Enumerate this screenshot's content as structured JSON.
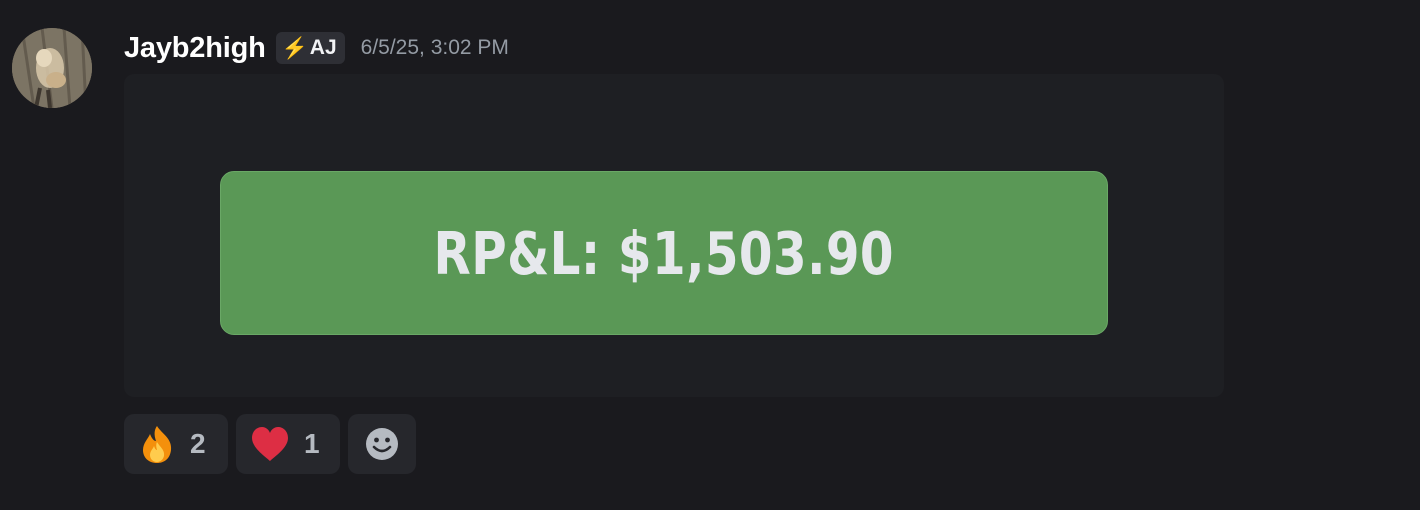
{
  "message": {
    "username": "Jayb2high",
    "role_tag": "AJ",
    "role_icon": "bolt-icon",
    "timestamp": "6/5/25, 3:02 PM"
  },
  "embed": {
    "pnl_text": "RP&L: $1,503.90",
    "card_color": "#5a9856"
  },
  "reactions": [
    {
      "emoji": "fire-icon",
      "count": "2"
    },
    {
      "emoji": "heart-icon",
      "count": "1"
    },
    {
      "emoji": "add-reaction-smiley-icon"
    }
  ]
}
